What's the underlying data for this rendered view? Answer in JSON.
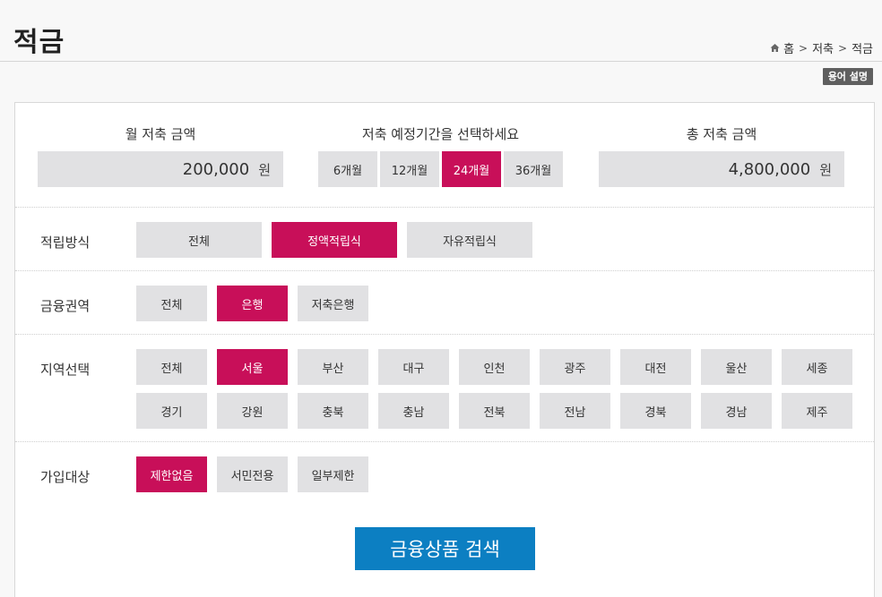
{
  "header": {
    "title": "적금",
    "breadcrumb": [
      "홈",
      "저축",
      "적금"
    ],
    "glossary_label": "용어 설명"
  },
  "amount": {
    "monthly_label": "월 저축 금액",
    "monthly_value": "200,000",
    "period_label": "저축 예정기간을 선택하세요",
    "periods": [
      "6개월",
      "12개월",
      "24개월",
      "36개월"
    ],
    "selected_period": "24개월",
    "total_label": "총 저축 금액",
    "total_value": "4,800,000",
    "unit": "원"
  },
  "filters": {
    "method": {
      "label": "적립방식",
      "options": [
        "전체",
        "정액적립식",
        "자유적립식"
      ],
      "selected": "정액적립식"
    },
    "sector": {
      "label": "금융권역",
      "options": [
        "전체",
        "은행",
        "저축은행"
      ],
      "selected": "은행"
    },
    "region": {
      "label": "지역선택",
      "options": [
        "전체",
        "서울",
        "부산",
        "대구",
        "인천",
        "광주",
        "대전",
        "울산",
        "세종",
        "경기",
        "강원",
        "충북",
        "충남",
        "전북",
        "전남",
        "경북",
        "경남",
        "제주"
      ],
      "selected": "서울"
    },
    "target": {
      "label": "가입대상",
      "options": [
        "제한없음",
        "서민전용",
        "일부제한"
      ],
      "selected": "제한없음"
    }
  },
  "search_button": "금융상품 검색",
  "colors": {
    "accent": "#c80f59",
    "button_gray": "#e1e1e3",
    "search_blue": "#0c7fc2"
  }
}
